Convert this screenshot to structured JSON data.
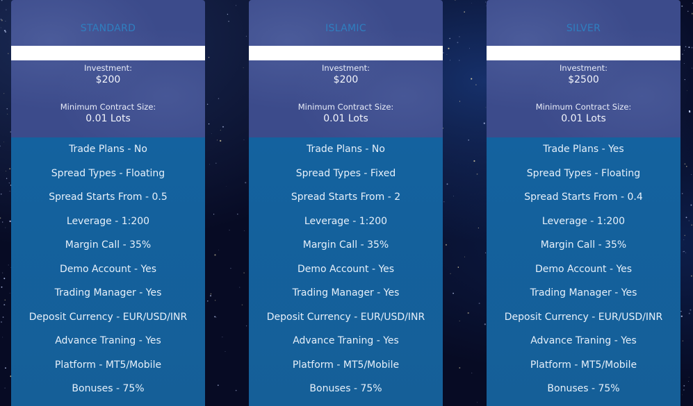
{
  "labels": {
    "investment": "Investment:",
    "min_contract": "Minimum Contract Size:"
  },
  "colors": {
    "page_bg": "#070b24",
    "card_top": "#3c4b8b",
    "card_features": "#14629f",
    "title_text": "#2f7fc0",
    "bar": "#ffffff"
  },
  "plans": [
    {
      "title": "STANDARD",
      "investment": "$200",
      "min_contract": "0.01 Lots",
      "features": [
        "Trade Plans - No",
        "Spread Types - Floating",
        "Spread Starts From - 0.5",
        "Leverage - 1:200",
        "Margin Call - 35%",
        "Demo Account - Yes",
        "Trading Manager - Yes",
        "Deposit Currency - EUR/USD/INR",
        "Advance Traning - Yes",
        "Platform - MT5/Mobile",
        "Bonuses - 75%"
      ]
    },
    {
      "title": "ISLAMIC",
      "investment": "$200",
      "min_contract": "0.01 Lots",
      "features": [
        "Trade Plans - No",
        "Spread Types - Fixed",
        "Spread Starts From - 2",
        "Leverage - 1:200",
        "Margin Call - 35%",
        "Demo Account - Yes",
        "Trading Manager - Yes",
        "Deposit Currency - EUR/USD/INR",
        "Advance Traning - Yes",
        "Platform - MT5/Mobile",
        "Bonuses - 75%"
      ]
    },
    {
      "title": "SILVER",
      "investment": "$2500",
      "min_contract": "0.01 Lots",
      "features": [
        "Trade Plans - Yes",
        "Spread Types - Floating",
        "Spread Starts From - 0.4",
        "Leverage - 1:200",
        "Margin Call - 35%",
        "Demo Account - Yes",
        "Trading Manager - Yes",
        "Deposit Currency - EUR/USD/INR",
        "Advance Traning - Yes",
        "Platform - MT5/Mobile",
        "Bonuses - 75%"
      ]
    }
  ]
}
